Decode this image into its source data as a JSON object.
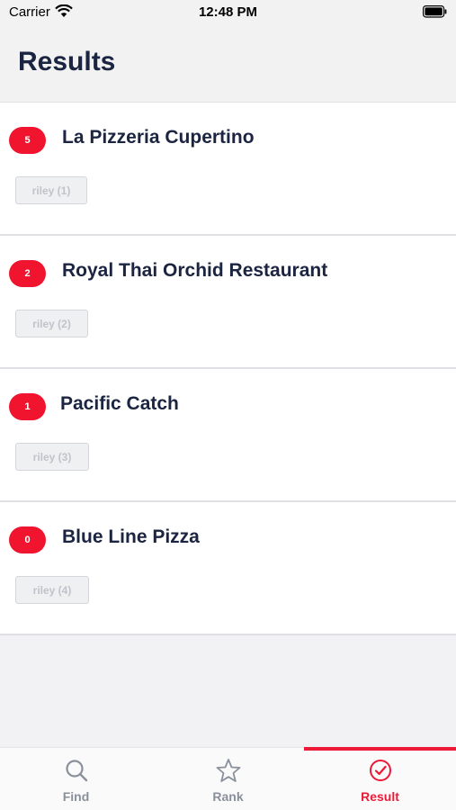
{
  "status_bar": {
    "carrier": "Carrier",
    "time": "12:48 PM"
  },
  "header": {
    "title": "Results"
  },
  "results": [
    {
      "count": "5",
      "name": "La Pizzeria Cupertino",
      "voter": "riley (1)"
    },
    {
      "count": "2",
      "name": "Royal Thai Orchid Restaurant",
      "voter": "riley (2)"
    },
    {
      "count": "1",
      "name": "Pacific Catch",
      "voter": "riley (3)"
    },
    {
      "count": "0",
      "name": "Blue Line Pizza",
      "voter": "riley (4)"
    }
  ],
  "tab_bar": {
    "tabs": [
      {
        "label": "Find",
        "icon": "search-icon",
        "active": false
      },
      {
        "label": "Rank",
        "icon": "star-icon",
        "active": false
      },
      {
        "label": "Result",
        "icon": "check-circle-icon",
        "active": true
      }
    ]
  },
  "colors": {
    "accent": "#ec1a37",
    "title": "#1b2440",
    "inactive_tab": "#8a8f9c"
  }
}
